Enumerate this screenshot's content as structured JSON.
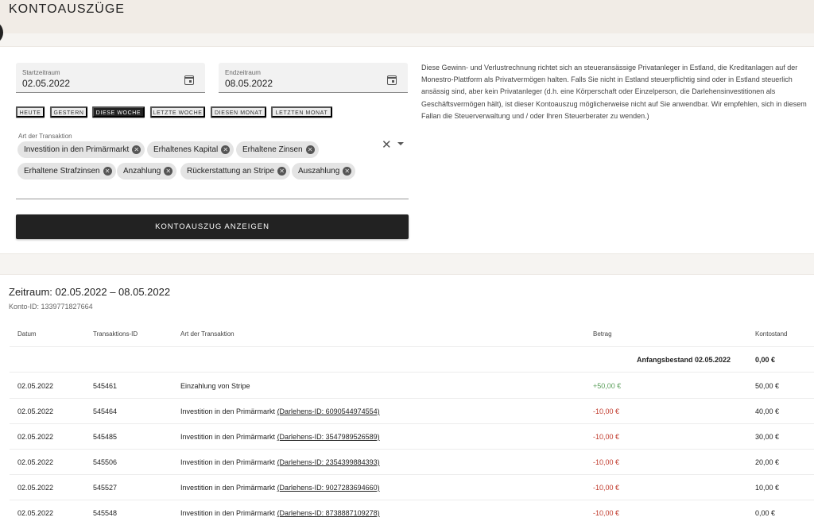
{
  "header": {
    "title": "KONTOAUSZÜGE"
  },
  "filters": {
    "start": {
      "label": "Startzeitraum",
      "value": "02.05.2022"
    },
    "end": {
      "label": "Endzeitraum",
      "value": "08.05.2022"
    },
    "quick_ranges": [
      {
        "label": "HEUTE",
        "active": false
      },
      {
        "label": "GESTERN",
        "active": false
      },
      {
        "label": "DIESE WOCHE",
        "active": true
      },
      {
        "label": "LETZTE WOCHE",
        "active": false
      },
      {
        "label": "DIESEN MONAT",
        "active": false
      },
      {
        "label": "LETZTEN MONAT",
        "active": false
      }
    ],
    "transaction_type_label": "Art der Transaktion",
    "chips": [
      "Investition in den Primärmarkt",
      "Erhaltenes Kapital",
      "Erhaltene Zinsen",
      "Erhaltene Strafzinsen",
      "Anzahlung",
      "Rückerstattung an Stripe",
      "Auszahlung"
    ],
    "show_button": "KONTOAUSZUG ANZEIGEN",
    "info_text": "Diese Gewinn- und Verlustrechnung richtet sich an steueransässige Privatanleger in Estland, die Kreditanlagen auf der Monestro-Plattform als Privatvermögen halten. Falls Sie nicht in Estland steuerpflichtig sind oder in Estland steuerlich ansässig sind, aber kein Privatanleger (d.h. eine Körperschaft oder Einzelperson, die Darlehensinvestitionen als Geschäftsvermögen hält), ist dieser Kontoauszug möglicherweise nicht auf Sie anwendbar. Wir empfehlen, sich in diesem Fallan die Steuerverwaltung und / oder Ihren Steuerberater zu wenden.)"
  },
  "statement": {
    "period": "Zeitraum: 02.05.2022 – 08.05.2022",
    "account_id": "Konto-ID: 1339771827664",
    "columns": {
      "date": "Datum",
      "id": "Transaktions-ID",
      "type": "Art der Transaktion",
      "amount": "Betrag",
      "balance": "Kontostand"
    },
    "opening": {
      "label": "Anfangsbestand 02.05.2022",
      "value": "0,00 €"
    },
    "rows": [
      {
        "date": "02.05.2022",
        "id": "545461",
        "type": "Einzahlung von Stripe",
        "loan": "",
        "amount": "+50,00 €",
        "sign": "pos",
        "balance": "50,00 €"
      },
      {
        "date": "02.05.2022",
        "id": "545464",
        "type": "Investition in den Primärmarkt",
        "loan": "(Darlehens-ID: 6090544974554)",
        "amount": "-10,00 €",
        "sign": "neg",
        "balance": "40,00 €"
      },
      {
        "date": "02.05.2022",
        "id": "545485",
        "type": "Investition in den Primärmarkt",
        "loan": "(Darlehens-ID: 3547989526589)",
        "amount": "-10,00 €",
        "sign": "neg",
        "balance": "30,00 €"
      },
      {
        "date": "02.05.2022",
        "id": "545506",
        "type": "Investition in den Primärmarkt",
        "loan": "(Darlehens-ID: 2354399884393)",
        "amount": "-10,00 €",
        "sign": "neg",
        "balance": "20,00 €"
      },
      {
        "date": "02.05.2022",
        "id": "545527",
        "type": "Investition in den Primärmarkt",
        "loan": "(Darlehens-ID: 9027283694660)",
        "amount": "-10,00 €",
        "sign": "neg",
        "balance": "10,00 €"
      },
      {
        "date": "02.05.2022",
        "id": "545548",
        "type": "Investition in den Primärmarkt",
        "loan": "(Darlehens-ID: 8738887109278)",
        "amount": "-10,00 €",
        "sign": "neg",
        "balance": "0,00 €"
      }
    ]
  },
  "colors": {
    "accent": "#222222",
    "positive": "#5a9e5a",
    "negative": "#c0392b",
    "header_bg": "#f1ece6"
  },
  "icons": [
    "calendar-icon",
    "close-icon",
    "chevron-down-icon"
  ]
}
